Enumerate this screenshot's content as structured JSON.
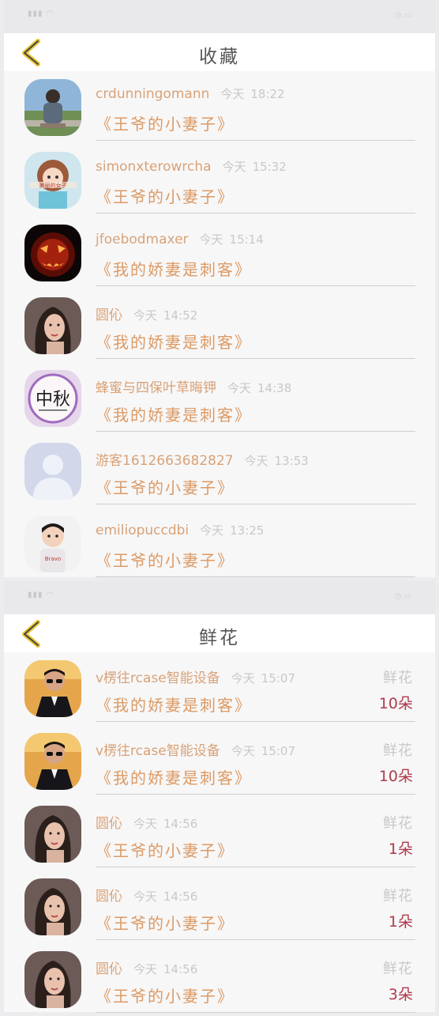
{
  "favorites": {
    "title": "收藏",
    "items": [
      {
        "name": "crdunningomann",
        "day": "今天",
        "time": "18:22",
        "book": "《王爷的小妻子》",
        "avatar": "man-on-bench-avatar"
      },
      {
        "name": "simonxterowrcha",
        "day": "今天",
        "time": "15:32",
        "book": "《王爷的小妻子》",
        "avatar": "girl-cartoon-avatar"
      },
      {
        "name": "jfoebodmaxer",
        "day": "今天",
        "time": "15:14",
        "book": "《我的娇妻是刺客》",
        "avatar": "pumpkin-avatar"
      },
      {
        "name": "圆伈",
        "day": "今天",
        "time": "14:52",
        "book": "《我的娇妻是刺客》",
        "avatar": "woman-portrait-avatar"
      },
      {
        "name": "蜂蜜与四保叶草晦钾",
        "day": "今天",
        "time": "14:38",
        "book": "《我的娇妻是刺客》",
        "avatar": "calligraphy-avatar"
      },
      {
        "name": "游客1612663682827",
        "day": "今天",
        "time": "13:53",
        "book": "《王爷的小妻子》",
        "avatar": "default-user-avatar"
      },
      {
        "name": "emiliopuccdbi",
        "day": "今天",
        "time": "13:25",
        "book": "《王爷的小妻子》",
        "avatar": "child-avatar"
      }
    ]
  },
  "flowers": {
    "title": "鲜花",
    "items": [
      {
        "name": "v楞往rcase智能设备",
        "day": "今天",
        "time": "15:07",
        "book": "《我的娇妻是刺客》",
        "label": "鲜花",
        "count": "10朵",
        "avatar": "man-sunglasses-avatar"
      },
      {
        "name": "v楞往rcase智能设备",
        "day": "今天",
        "time": "15:07",
        "book": "《我的娇妻是刺客》",
        "label": "鲜花",
        "count": "10朵",
        "avatar": "man-sunglasses-avatar"
      },
      {
        "name": "圆伈",
        "day": "今天",
        "time": "14:56",
        "book": "《王爷的小妻子》",
        "label": "鲜花",
        "count": "1朵",
        "avatar": "woman-portrait-avatar"
      },
      {
        "name": "圆伈",
        "day": "今天",
        "time": "14:56",
        "book": "《王爷的小妻子》",
        "label": "鲜花",
        "count": "1朵",
        "avatar": "woman-portrait-avatar"
      },
      {
        "name": "圆伈",
        "day": "今天",
        "time": "14:56",
        "book": "《王爷的小妻子》",
        "label": "鲜花",
        "count": "3朵",
        "avatar": "woman-portrait-avatar"
      }
    ]
  },
  "colors": {
    "accent": "#dd9a63",
    "username": "#d9a276",
    "meta": "#c8c8c8",
    "count": "#b03a4a",
    "back_arrow": "#e8c534"
  }
}
